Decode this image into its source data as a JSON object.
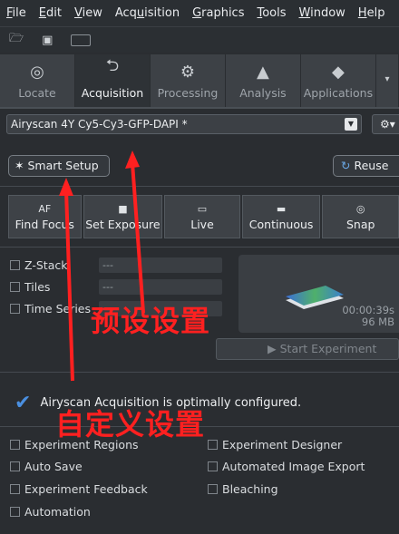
{
  "menubar": {
    "items": [
      {
        "label": "File",
        "u": "F",
        "rest": "ile"
      },
      {
        "label": "Edit",
        "u": "E",
        "rest": "dit"
      },
      {
        "label": "View",
        "u": "V",
        "rest": "iew"
      },
      {
        "label": "Acquisition",
        "pre": "Acq",
        "u": "u",
        "rest": "isition"
      },
      {
        "label": "Graphics",
        "u": "G",
        "rest": "raphics"
      },
      {
        "label": "Tools",
        "u": "T",
        "rest": "ools"
      },
      {
        "label": "Window",
        "u": "W",
        "rest": "indow"
      },
      {
        "label": "Help",
        "u": "H",
        "rest": "elp"
      }
    ]
  },
  "tabs": [
    {
      "label": "Locate",
      "icon": "locate-icon",
      "active": false
    },
    {
      "label": "Acquisition",
      "icon": "acquisition-icon",
      "active": true
    },
    {
      "label": "Processing",
      "icon": "processing-icon",
      "active": false
    },
    {
      "label": "Analysis",
      "icon": "analysis-icon",
      "active": false
    },
    {
      "label": "Applications",
      "icon": "applications-icon",
      "active": false
    }
  ],
  "experiment": {
    "selected": "Airyscan 4Y Cy5-Cy3-GFP-DAPI *"
  },
  "smart_setup_label": "Smart Setup",
  "reuse_label": "Reuse",
  "actions": [
    {
      "label": "Find Focus",
      "icon": "AF"
    },
    {
      "label": "Set Exposure",
      "icon": "camera-icon"
    },
    {
      "label": "Live",
      "icon": "live-icon"
    },
    {
      "label": "Continuous",
      "icon": "continuous-icon"
    },
    {
      "label": "Snap",
      "icon": "snap-icon"
    }
  ],
  "dimensions": [
    {
      "label": "Z-Stack",
      "value": "---"
    },
    {
      "label": "Tiles",
      "value": "---"
    },
    {
      "label": "Time Series",
      "value": "---"
    }
  ],
  "preview": {
    "time": "00:00:39s",
    "size": "96 MB"
  },
  "start_experiment_label": "Start Experiment",
  "status_message": "Airyscan Acquisition is optimally configured.",
  "options": [
    {
      "label": "Experiment Regions"
    },
    {
      "label": "Experiment Designer"
    },
    {
      "label": "Auto Save"
    },
    {
      "label": "Automated Image Export"
    },
    {
      "label": "Experiment Feedback"
    },
    {
      "label": "Bleaching"
    },
    {
      "label": "Automation"
    }
  ],
  "annotations": {
    "preset": "预设设置",
    "custom": "自定义设置"
  },
  "colors": {
    "annotation": "#ff2020",
    "check": "#4a8fe0",
    "background": "#2a2d31"
  }
}
